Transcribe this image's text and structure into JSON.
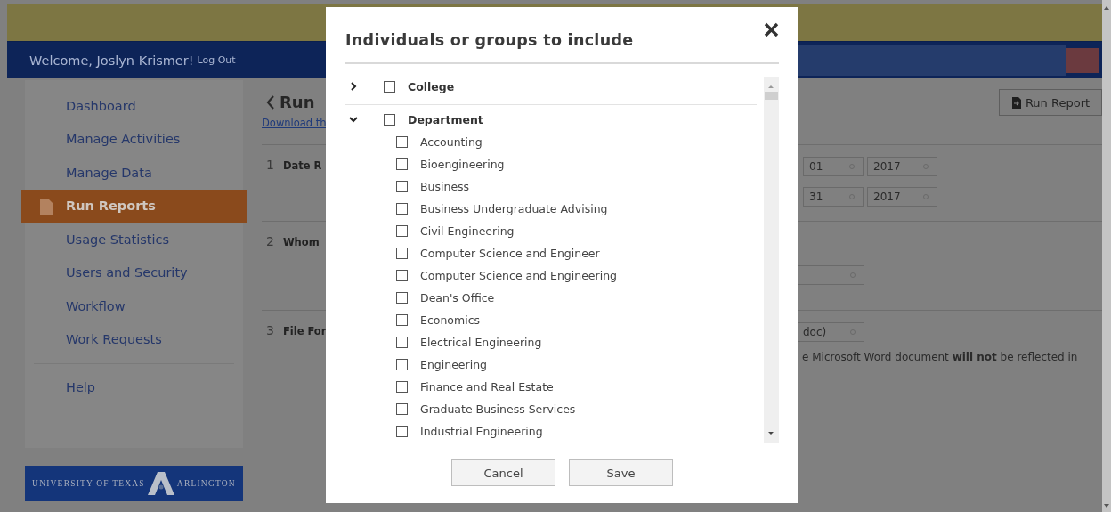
{
  "header": {
    "welcome": "Welcome, Joslyn Krismer!",
    "logout": "Log Out"
  },
  "sidebar": {
    "groups": [
      [
        {
          "label": "Dashboard",
          "selected": false
        },
        {
          "label": "Manage Activities",
          "selected": false
        },
        {
          "label": "Manage Data",
          "selected": false
        },
        {
          "label": "Run Reports",
          "selected": true
        },
        {
          "label": "Usage Statistics",
          "selected": false
        },
        {
          "label": "Users and Security",
          "selected": false
        },
        {
          "label": "Workflow",
          "selected": false
        },
        {
          "label": "Work Requests",
          "selected": false
        }
      ],
      [
        {
          "label": "Help",
          "selected": false
        }
      ]
    ]
  },
  "logo": {
    "left": "UNIVERSITY OF TEXAS",
    "right": "ARLINGTON"
  },
  "main": {
    "title": "Run",
    "link": "Download th",
    "run_button": "Run Report",
    "sections": [
      {
        "number": "1",
        "label": "Date R",
        "field_rows": [
          [
            {
              "value": "01"
            },
            {
              "value": "2017"
            }
          ],
          [
            {
              "value": "31"
            },
            {
              "value": "2017"
            }
          ]
        ]
      },
      {
        "number": "2",
        "label": "Whom",
        "field_rows": [
          [
            {}
          ]
        ]
      },
      {
        "number": "3",
        "label": "File For",
        "field_rows": [
          [
            {
              "value": "doc)"
            }
          ]
        ],
        "note": "e Microsoft Word document **will not** be reflected in"
      }
    ]
  },
  "modal": {
    "title": "Individuals or groups to include",
    "tree": [
      {
        "label": "College",
        "expanded": false,
        "checked": false
      },
      {
        "label": "Department",
        "expanded": true,
        "checked": false,
        "children": [
          {
            "label": "Accounting",
            "checked": false
          },
          {
            "label": "Bioengineering",
            "checked": false
          },
          {
            "label": "Business",
            "checked": false
          },
          {
            "label": "Business Undergraduate Advising",
            "checked": false
          },
          {
            "label": "Civil Engineering",
            "checked": false
          },
          {
            "label": "Computer Science and Engineer",
            "checked": false
          },
          {
            "label": "Computer Science and Engineering",
            "checked": false
          },
          {
            "label": "Dean's Office",
            "checked": false
          },
          {
            "label": "Economics",
            "checked": false
          },
          {
            "label": "Electrical Engineering",
            "checked": false
          },
          {
            "label": "Engineering",
            "checked": false
          },
          {
            "label": "Finance and Real Estate",
            "checked": false
          },
          {
            "label": "Graduate Business Services",
            "checked": false
          },
          {
            "label": "Industrial Engineering",
            "checked": false
          }
        ]
      }
    ],
    "buttons": [
      "Cancel",
      "Save"
    ]
  }
}
